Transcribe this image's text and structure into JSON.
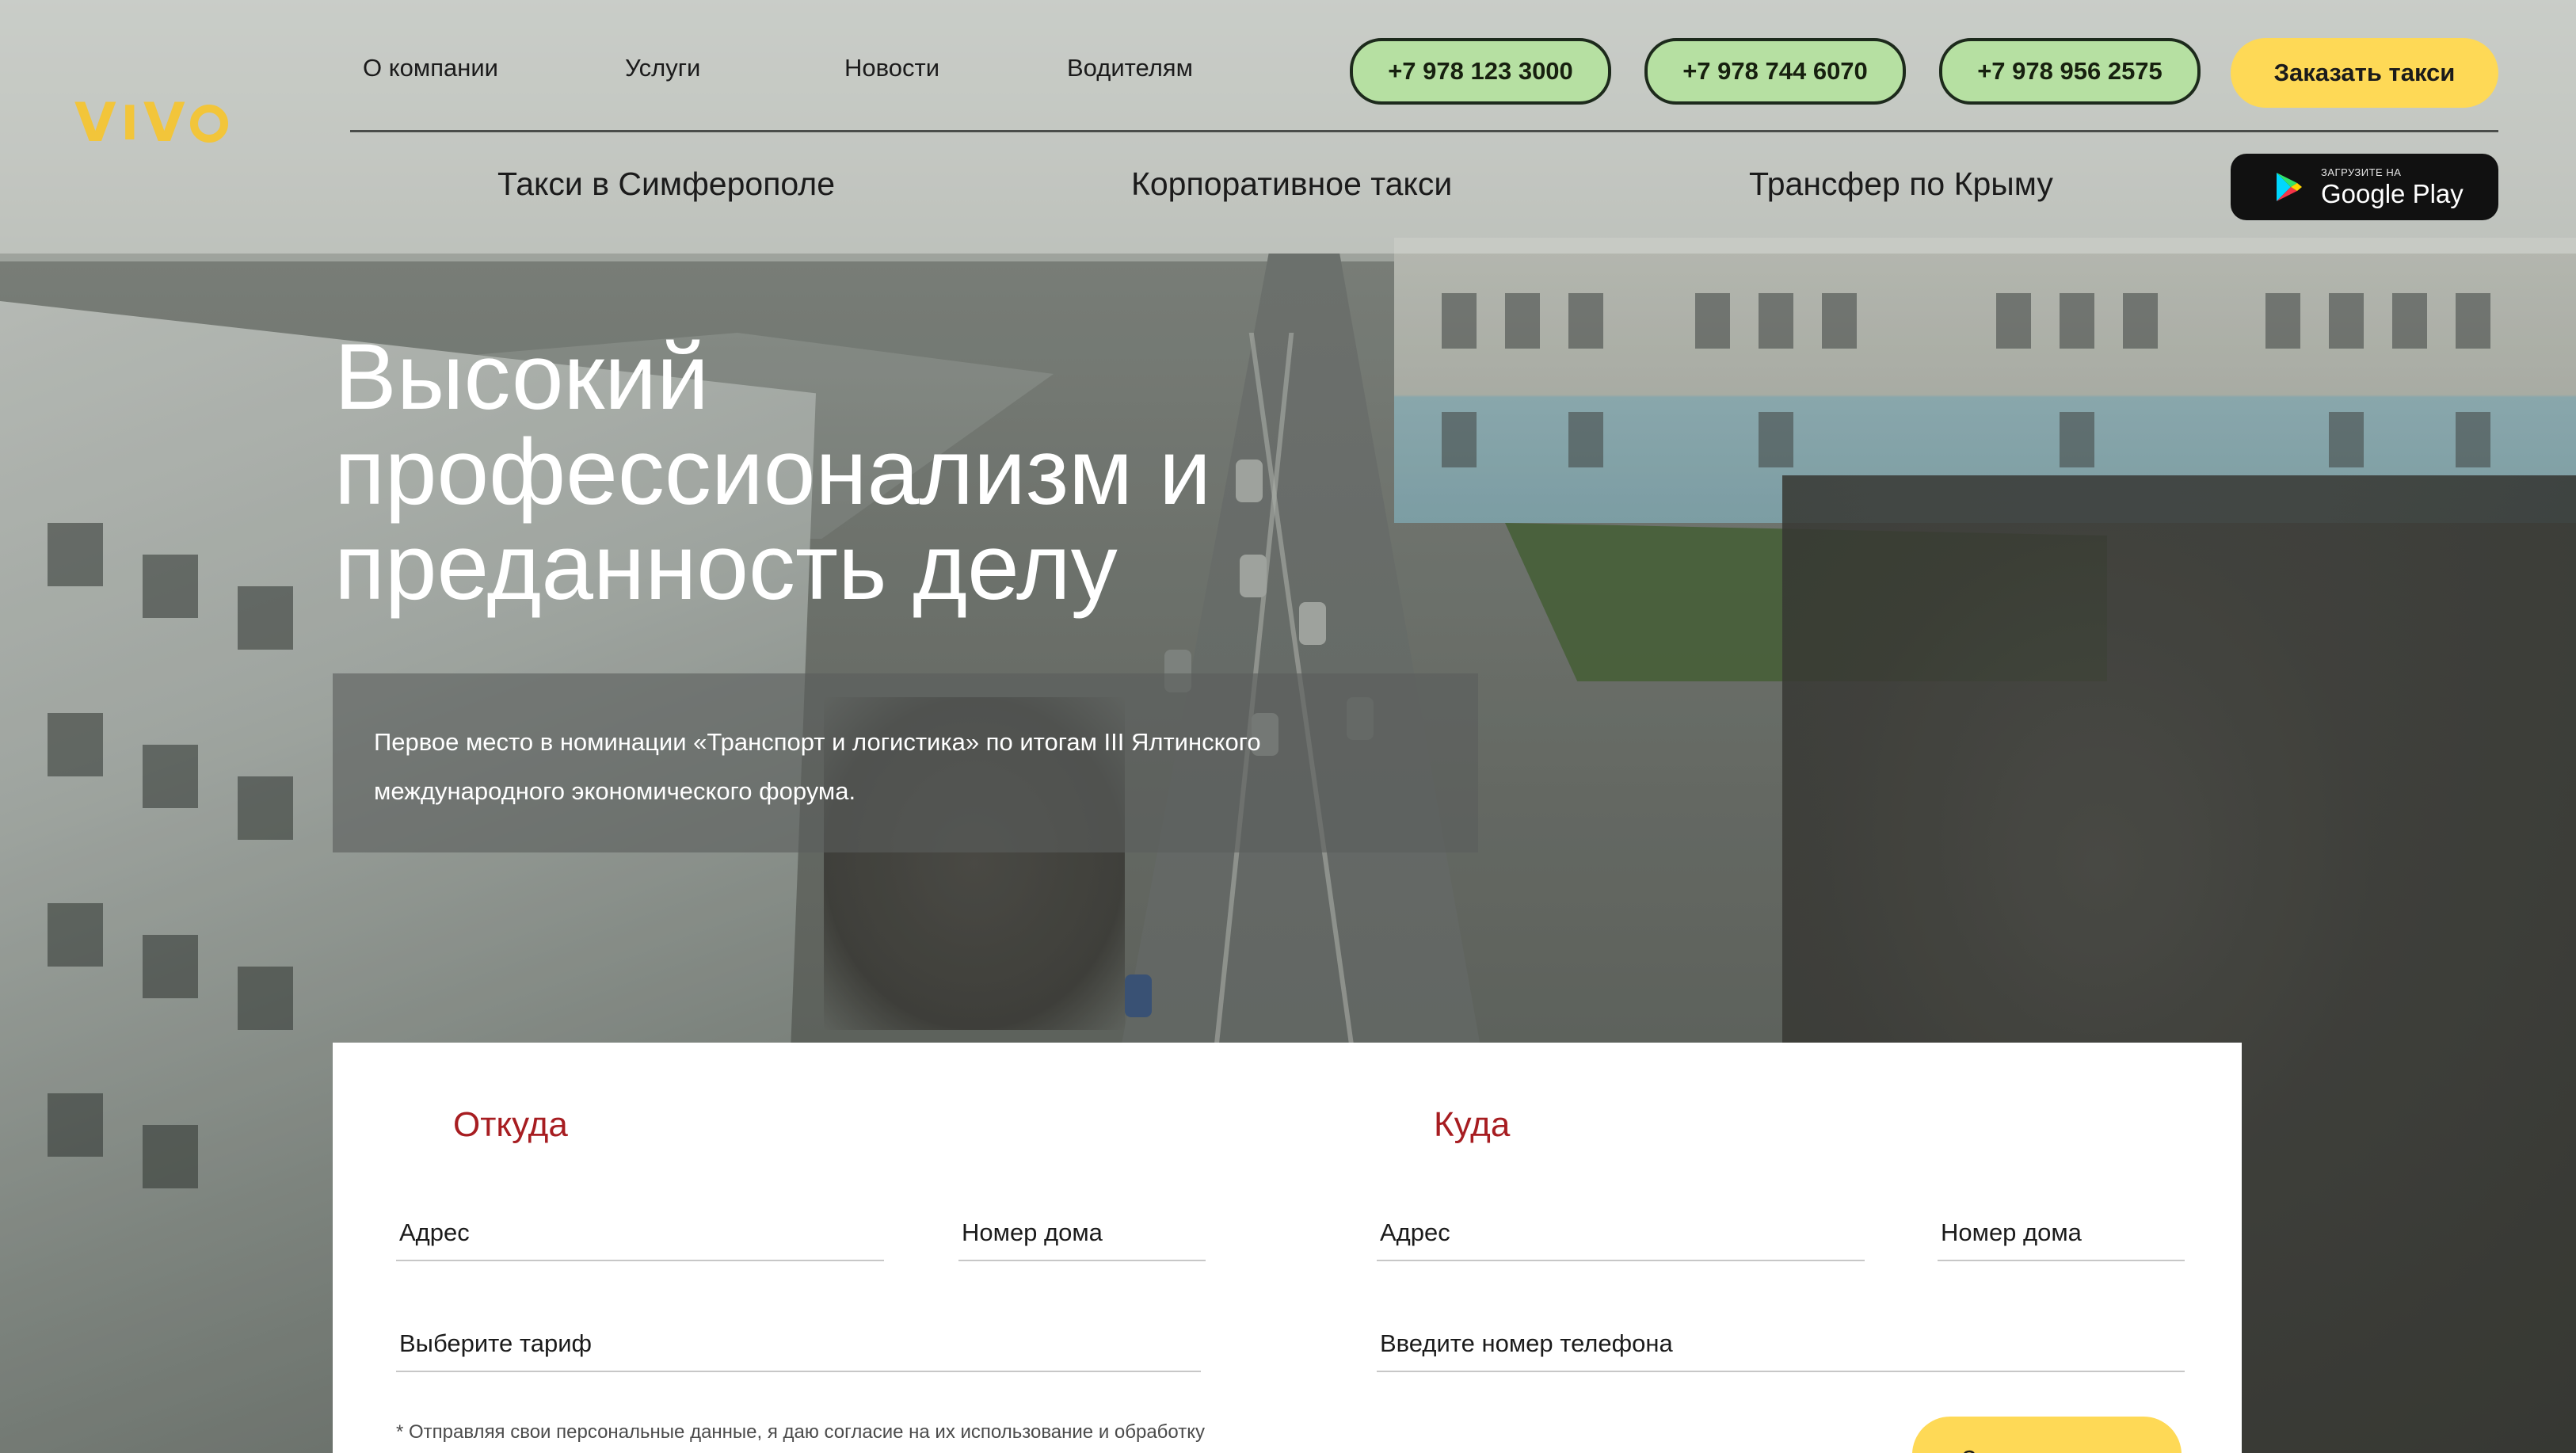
{
  "header": {
    "nav": [
      "О компании",
      "Услуги",
      "Новости",
      "Водителям"
    ],
    "phones": [
      "+7 978 123 3000",
      "+7 978 744 6070",
      "+7 978 956 2575"
    ],
    "order_button": "Заказать такси",
    "subnav": [
      "Такси в Симферополе",
      "Корпоративное такси",
      "Трансфер по Крыму"
    ],
    "google_play": {
      "small": "ЗАГРУЗИТЕ НА",
      "big": "Google Play"
    }
  },
  "logo": {
    "text": "VIVO",
    "color": "#f2c53a"
  },
  "hero": {
    "title_lines": [
      "Высокий",
      "профессионализм и",
      "преданность делу"
    ],
    "description": "Первое место в номинации «Транспорт и логистика» по итогам III Ялтинского международного экономического форума."
  },
  "form": {
    "from_heading": "Откуда",
    "to_heading": "Куда",
    "from_address_placeholder": "Адрес",
    "from_house_placeholder": "Номер дома",
    "to_address_placeholder": "Адрес",
    "to_house_placeholder": "Номер дома",
    "tariff_placeholder": "Выберите тариф",
    "phone_placeholder": "Введите номер телефона",
    "consent": "* Отправляя свои персональные данные, я даю согласие на их использование и обработку",
    "submit": "Заказать такси"
  },
  "colors": {
    "accent_yellow": "#fed956",
    "phone_green": "#b6e0a2",
    "heading_red": "#a71d21"
  }
}
